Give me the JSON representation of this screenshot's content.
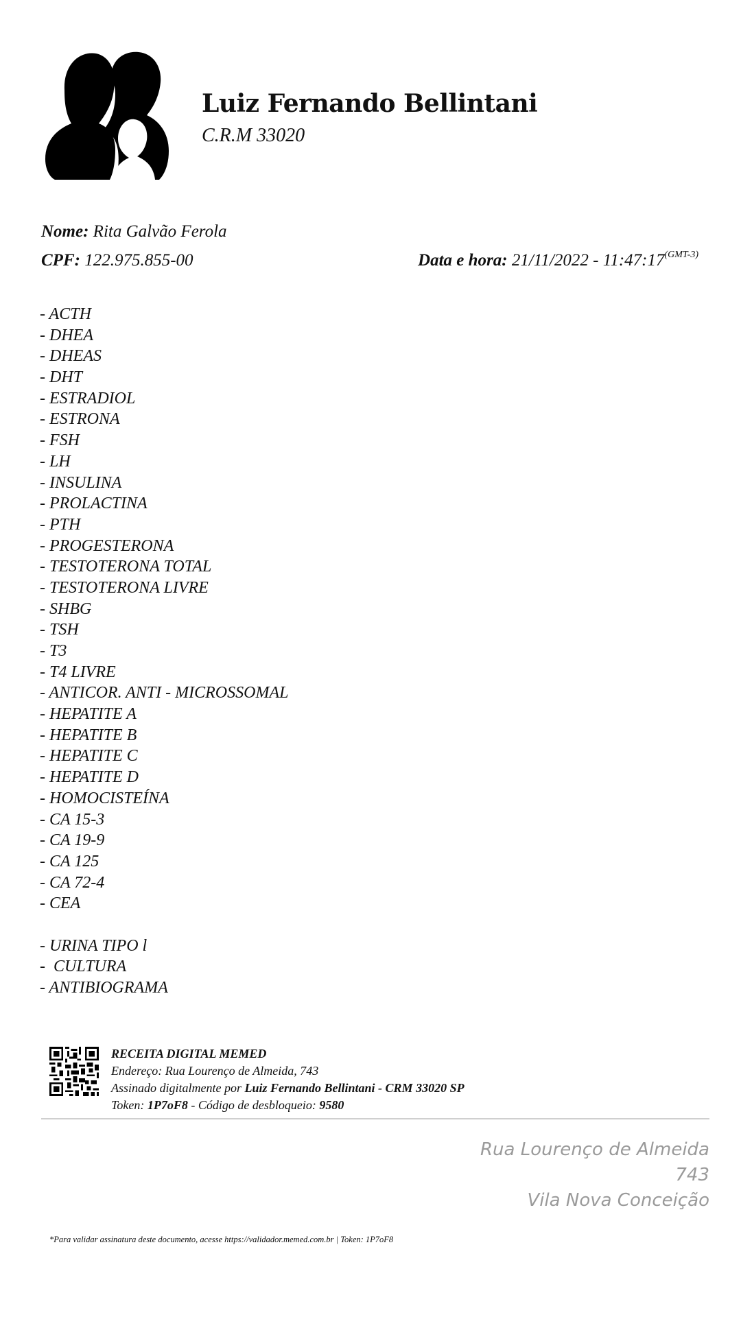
{
  "doctor": {
    "name": "Luiz Fernando Bellintani",
    "crm": "C.R.M 33020"
  },
  "patient": {
    "name_label": "Nome:",
    "name": "Rita Galvão Ferola",
    "cpf_label": "CPF:",
    "cpf": "122.975.855-00",
    "datetime_label": "Data e hora:",
    "datetime": "21/11/2022 - 11:47:17",
    "timezone": "(GMT-3)"
  },
  "exams": [
    "- ACTH",
    "- DHEA",
    "- DHEAS",
    "- DHT",
    "- ESTRADIOL",
    "- ESTRONA",
    "- FSH",
    "- LH",
    "- INSULINA",
    "- PROLACTINA",
    "- PTH",
    "- PROGESTERONA",
    "- TESTOTERONA TOTAL",
    "- TESTOTERONA LIVRE",
    "- SHBG",
    "- TSH",
    "- T3",
    "- T4 LIVRE",
    "- ANTICOR. ANTI - MICROSSOMAL",
    "- HEPATITE A",
    "- HEPATITE B",
    "- HEPATITE C",
    "- HEPATITE D",
    "- HOMOCISTEÍNA",
    "- CA 15-3",
    "- CA 19-9",
    "- CA 125",
    "- CA 72-4",
    "- CEA"
  ],
  "exams_urine": [
    "- URINA TIPO l",
    "-  CULTURA",
    "- ANTIBIOGRAMA"
  ],
  "signature": {
    "title": "RECEITA DIGITAL MEMED",
    "address": "Endereço: Rua Lourenço de Almeida, 743",
    "signed_prefix": "Assinado digitalmente por",
    "signed_by": "Luiz Fernando Bellintani - CRM 33020 SP",
    "token_label": "Token:",
    "token": "1P7oF8",
    "unlock_label": "- Código de desbloqueio:",
    "unlock_code": "9580"
  },
  "address_block": {
    "line1": "Rua Lourenço de Almeida",
    "line2": "743",
    "line3": "Vila Nova Conceição"
  },
  "footer": {
    "note": "*Para validar assinatura deste documento, acesse https://validador.memed.com.br | Token: 1P7oF8"
  },
  "colors": {
    "text": "#111111",
    "address_gray": "#9a9a9a",
    "divider": "#cfcfcf"
  }
}
